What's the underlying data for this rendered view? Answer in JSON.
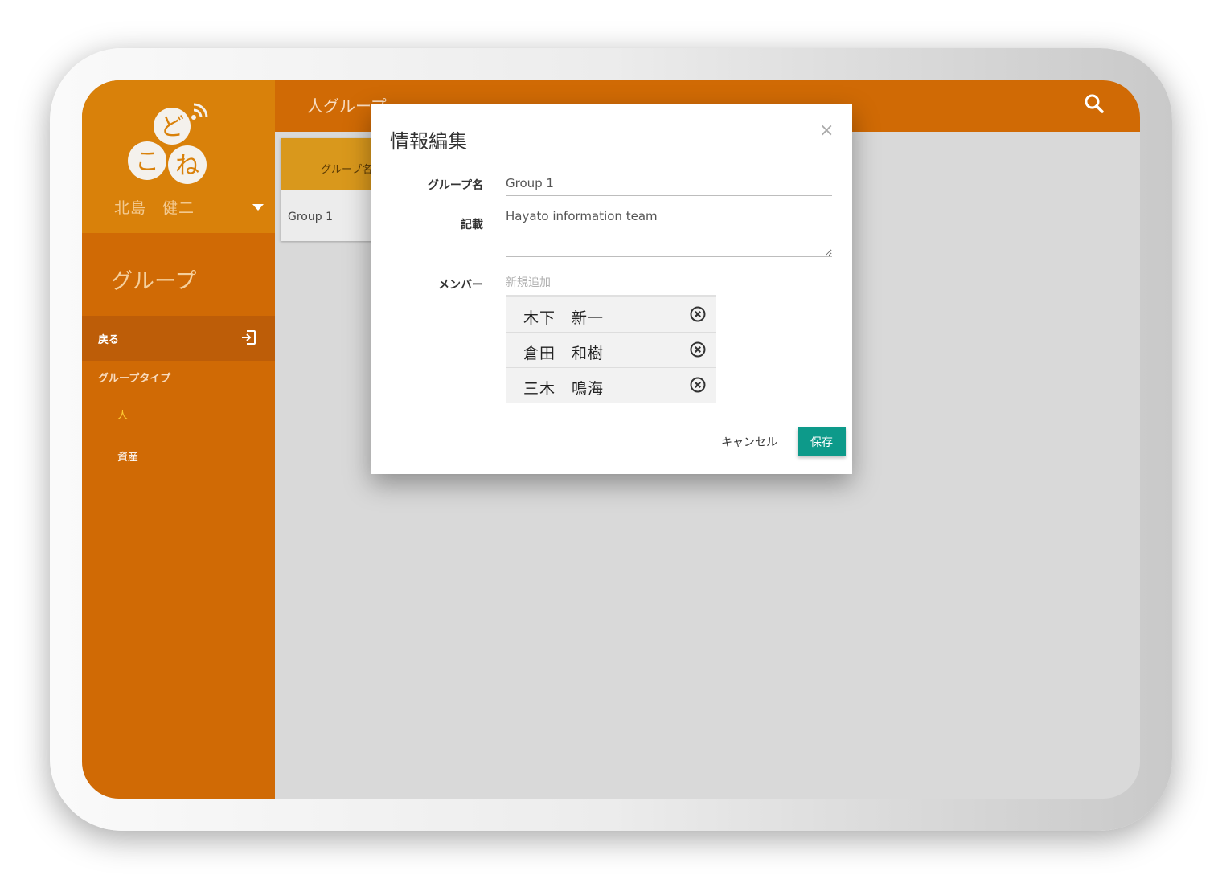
{
  "sidebar": {
    "user_name": "北島　健二",
    "section_title": "グループ",
    "back_label": "戻る",
    "group_type_label": "グループタイプ",
    "type_items": [
      {
        "label": "人"
      },
      {
        "label": "資産"
      }
    ]
  },
  "header": {
    "title": "人グループ"
  },
  "table": {
    "column_header": "グループ名",
    "rows": [
      {
        "name": "Group 1"
      }
    ]
  },
  "modal": {
    "title": "情報編集",
    "close_glyph": "×",
    "fields": {
      "name_label": "グループ名",
      "name_value": "Group 1",
      "desc_label": "記載",
      "desc_value": "Hayato information team",
      "member_label": "メンバー",
      "member_placeholder": "新規追加"
    },
    "members": [
      {
        "name": "木下　新一"
      },
      {
        "name": "倉田　和樹"
      },
      {
        "name": "三木　鳴海"
      }
    ],
    "cancel_label": "キャンセル",
    "save_label": "保存"
  },
  "colors": {
    "sidebar": "#d06a05",
    "header": "#d06a05",
    "logo_bg": "#d9810a",
    "accent_save": "#0d9a8a",
    "active_type": "#ffcc33"
  },
  "icons": [
    "logo-icon",
    "caret-down-icon",
    "exit-icon",
    "search-icon",
    "close-icon",
    "remove-circle-icon"
  ]
}
